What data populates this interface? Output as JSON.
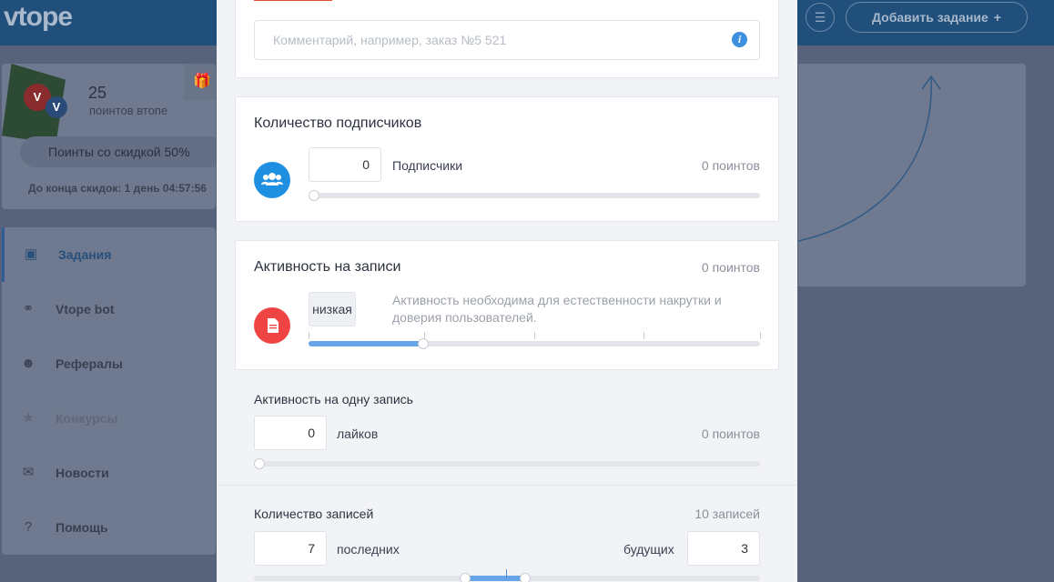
{
  "app": {
    "logo": "vtope",
    "menu_icon": "hamburger-icon",
    "add_task_label": "Добавить задание",
    "add_task_icon": "plus-icon"
  },
  "profile": {
    "points_value": "25",
    "points_label": "поинтов втопе",
    "discount_button": "Поинты со скидкой 50%",
    "discount_timer": "До конца скидок: 1 день 04:57:56"
  },
  "sidebar": {
    "items": [
      {
        "label": "Задания",
        "icon": "task-icon",
        "state": "active"
      },
      {
        "label": "Vtope bot",
        "icon": "bot-icon",
        "state": "normal"
      },
      {
        "label": "Рефералы",
        "icon": "referrals-icon",
        "state": "normal"
      },
      {
        "label": "Конкурсы",
        "icon": "trophy-icon",
        "state": "disabled"
      },
      {
        "label": "Новости",
        "icon": "mail-icon",
        "state": "normal"
      },
      {
        "label": "Помощь",
        "icon": "help-icon",
        "state": "normal"
      }
    ]
  },
  "modal": {
    "comment": {
      "placeholder": "Комментарий, например, заказ №5 521",
      "icon": "info-icon"
    },
    "subscribers": {
      "title": "Количество подписчиков",
      "value": "0",
      "label": "Подписчики",
      "points": "0 поинтов",
      "slider_fraction": 0.0,
      "icon": "users-icon",
      "icon_color": "#1f8fe1"
    },
    "activity": {
      "title": "Активность на записи",
      "points": "0 поинтов",
      "level": "низкая",
      "description": "Активность необходима для естественности накрутки и доверия пользователей.",
      "slider_fraction": 0.25,
      "icon": "document-icon",
      "icon_color": "#ef4444"
    },
    "per_post": {
      "title": "Активность на одну запись",
      "value": "0",
      "label": "лайков",
      "points": "0 поинтов",
      "slider_fraction": 0.0
    },
    "posts": {
      "title": "Количество записей",
      "total": "10 записей",
      "last_value": "7",
      "last_label": "последних",
      "future_label": "будущих",
      "future_value": "3"
    }
  }
}
